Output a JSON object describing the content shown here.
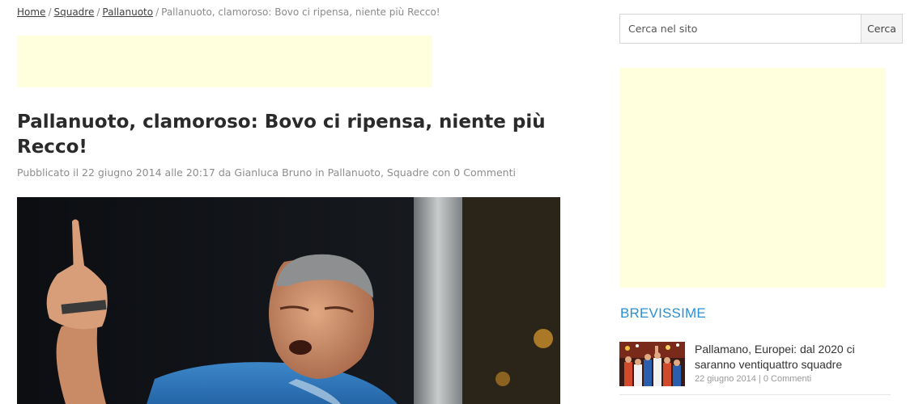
{
  "breadcrumb": {
    "items": [
      "Home",
      "Squadre",
      "Pallanuoto"
    ],
    "separator": "/",
    "current": "Pallanuoto, clamoroso: Bovo ci ripensa, niente più Recco!"
  },
  "post": {
    "title": "Pallanuoto, clamoroso: Bovo ci ripensa, niente più Recco!",
    "meta": {
      "prefix": "Pubblicato il",
      "date": "22 giugno 2014",
      "at": "alle",
      "time": "20:17",
      "by": "da",
      "author": "Gianluca Bruno",
      "in": "in",
      "category1": "Pallanuoto",
      "comma": ",",
      "category2": "Squadre",
      "with": "con",
      "comments": "0 Commenti"
    }
  },
  "search": {
    "placeholder": "Cerca nel sito",
    "button_label": "Cerca"
  },
  "sidebar": {
    "widget_title": "BREVISSIME",
    "news": [
      {
        "title": "Pallamano, Europei: dal 2020 ci saranno ventiquattro squadre",
        "date": "22 giugno 2014",
        "separator": "|",
        "comments": "0 Commenti"
      }
    ]
  },
  "colors": {
    "accent": "#2a8fd4",
    "ad_background": "#ffffdd"
  }
}
